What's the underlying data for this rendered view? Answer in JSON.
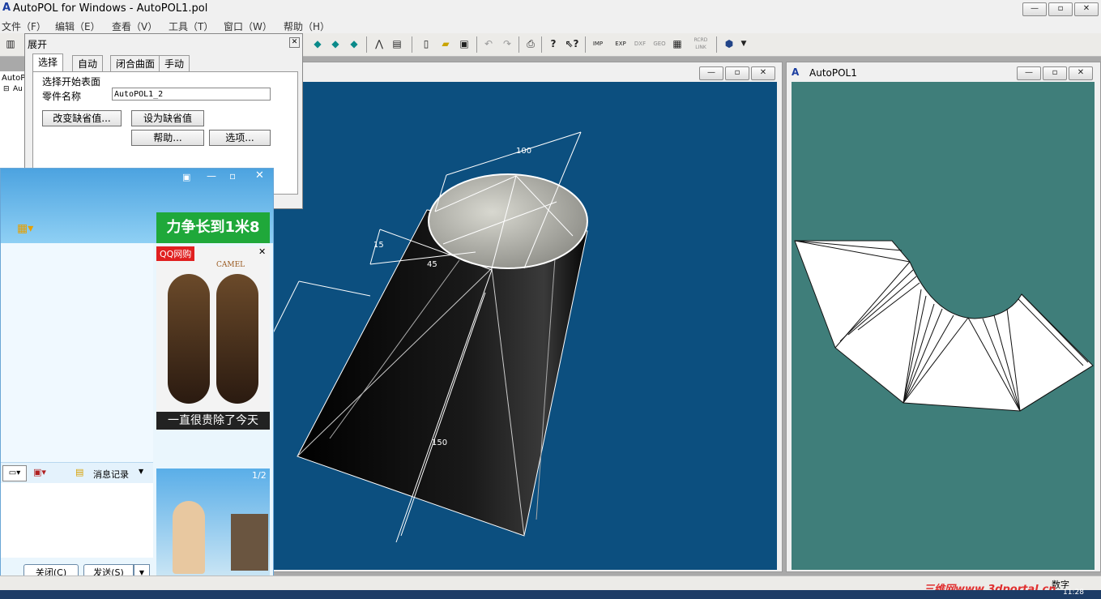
{
  "app": {
    "title": "AutoPOL for Windows - AutoPOL1.pol",
    "menus": [
      "文件（F）",
      "编辑（E）",
      "查看（V）",
      "工具（T）",
      "窗口（W）",
      "帮助（H）"
    ],
    "toolbar_labels": [
      "IMP",
      "EXP",
      "DXF",
      "GEO",
      "RCRD LINK"
    ]
  },
  "tree": {
    "root": "AutoP",
    "child": "Au"
  },
  "dialog": {
    "title": "展开",
    "tabs": [
      "选择",
      "自动",
      "闭合曲面",
      "手动"
    ],
    "heading": "选择开始表面",
    "part_label": "零件名称",
    "part_value": "AutoPOL1_2",
    "btn_change_default": "改变缺省值...",
    "btn_set_default": "设为缺省值",
    "btn_help": "帮助...",
    "btn_options": "选项..."
  },
  "view3d": {
    "dims": {
      "top": "100",
      "a": "15",
      "b": "45",
      "len": "150"
    }
  },
  "flatwin": {
    "title": "AutoPOL1"
  },
  "qq": {
    "ad1": "力争长到1米8",
    "ad2_brand": "QQ网购",
    "ad2_logo": "CAMEL",
    "ad2_caption": "一直很贵除了今天",
    "msg_history": "消息记录",
    "page": "1/2",
    "btn_close": "关闭(C)",
    "btn_send": "发送(S)"
  },
  "statusbar": {
    "mode": "数字"
  },
  "watermark": "三维网www.3dportal.cn",
  "clock": "11:28",
  "colors": {
    "view3d_bg": "#0c4f7f",
    "flat_bg": "#3f7e7a",
    "qq_border": "#6aa6d6"
  }
}
